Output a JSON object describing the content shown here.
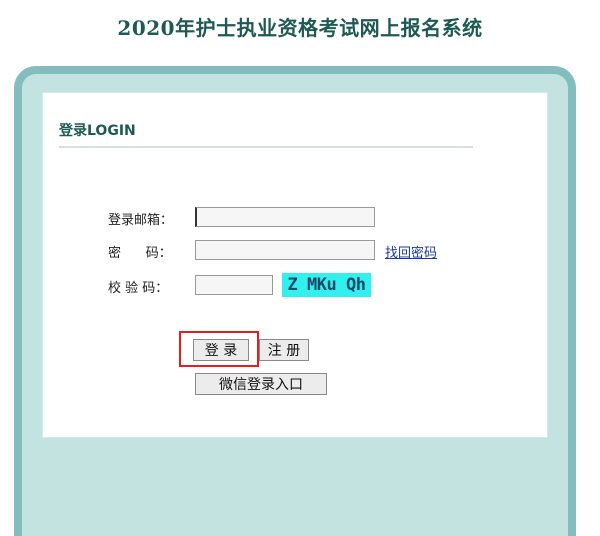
{
  "page": {
    "title": "2020年护士执业资格考试网上报名系统"
  },
  "login_panel": {
    "heading": "登录LOGIN",
    "email_label": "登录邮箱：",
    "email_value": "",
    "password_label": "密      码：",
    "password_value": "",
    "forgot_link": "找回密码",
    "captcha_label": "校 验 码：",
    "captcha_value": "",
    "captcha_text": "Z MKu Qh"
  },
  "buttons": {
    "login": "登 录",
    "register": "注 册",
    "wechat_login": "微信登录入口"
  },
  "colors": {
    "title": "#1e5a52",
    "frame": "#83bdbd",
    "frame_fill": "#c2e3e0",
    "captcha_bg": "#33f0f0",
    "highlight": "#e02020"
  }
}
